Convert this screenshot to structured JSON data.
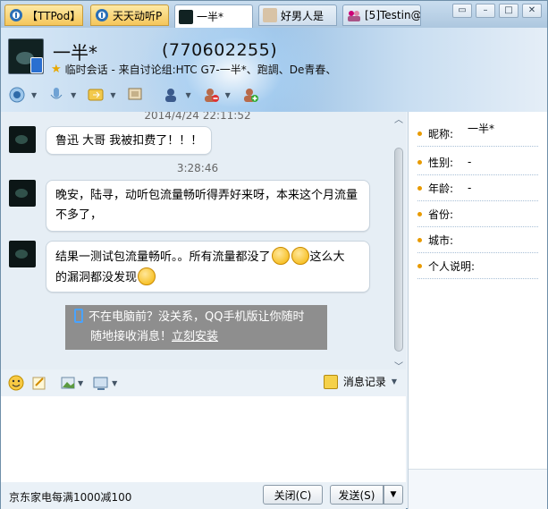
{
  "tabs": [
    {
      "label": "【TTPod】",
      "icon": "ttpod-icon",
      "style": "orange"
    },
    {
      "label": "天天动听P",
      "icon": "ttpod-icon",
      "style": "orange"
    },
    {
      "label": "一半*",
      "icon": "avatar-icon",
      "style": "active"
    },
    {
      "label": "好男人是",
      "icon": "avatar-icon",
      "style": "normal"
    },
    {
      "label": "[5]Testin@",
      "icon": "group-icon",
      "style": "normal"
    }
  ],
  "contact": {
    "nickname": "一半*",
    "qq": "(770602255)",
    "session": "临时会话 - 来自讨论组:HTC G7-一半*、跑調、De青春、"
  },
  "messages": [
    {
      "time": "2014/4/24 22:11:52",
      "text": "鲁迅 大哥 我被扣费了！！！"
    },
    {
      "time": "3:28:46",
      "lines": [
        "晚安，陆寻，动听包流量畅听得弄好来呀，本来这个月流量",
        "不多了，"
      ]
    },
    {
      "lines": [
        "结果一测试包流量畅听。。所有流量都没了",
        "这么大",
        "的漏洞都没发现"
      ]
    }
  ],
  "notice": {
    "line1": "不在电脑前？没关系，QQ手机版让你随时",
    "line2": "随地接收消息！",
    "link": "立刻安装"
  },
  "toolbar2": {
    "history": "消息记录"
  },
  "bottom": {
    "ad": "京东家电每满1000减100",
    "close": "关闭(C)",
    "send": "发送(S)"
  },
  "profile": {
    "fields": [
      {
        "label": "昵称:",
        "value": "一半*"
      },
      {
        "label": "性别:",
        "value": "-"
      },
      {
        "label": "年龄:",
        "value": "-"
      },
      {
        "label": "省份:",
        "value": ""
      },
      {
        "label": "城市:",
        "value": ""
      },
      {
        "label": "个人说明:",
        "value": ""
      }
    ]
  },
  "colors": {
    "accent": "#e89a00",
    "tab_orange": "#f5c65a",
    "notice_bg": "#8e8e8e",
    "link": "#ffffff"
  }
}
